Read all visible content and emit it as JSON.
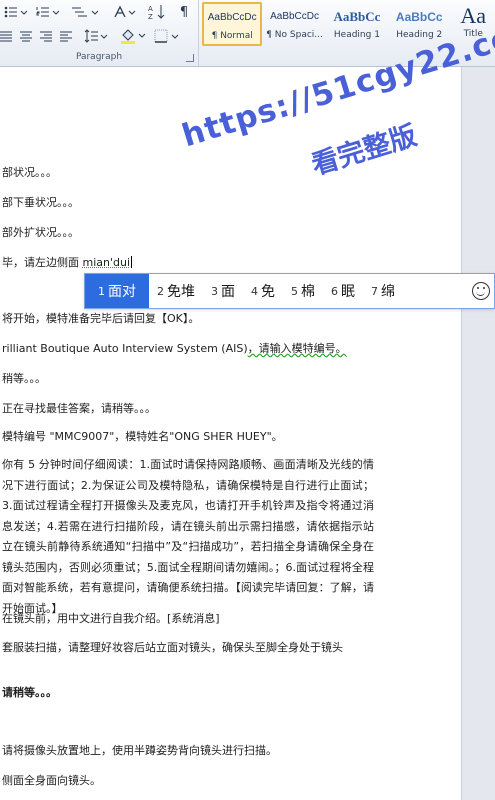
{
  "ribbon": {
    "paragraph_label": "Paragraph",
    "pilcrow": "¶",
    "sort_label": "A↓Z",
    "styles": [
      {
        "preview": "AaBbCcDc",
        "name": "¶ Normal",
        "active": true
      },
      {
        "preview": "AaBbCcDc",
        "name": "¶ No Spaci...",
        "active": false
      },
      {
        "preview": "AaBbCc",
        "name": "Heading 1",
        "active": false
      },
      {
        "preview": "AaBbCc",
        "name": "Heading 2",
        "active": false
      },
      {
        "preview": "Aa",
        "name": "Title",
        "active": false
      }
    ]
  },
  "watermark": {
    "line1": "https://51cgy22.com",
    "line2": "看完整版"
  },
  "document": {
    "lines": [
      "部状况。。。",
      "部下垂状况。。。",
      "部外扩状况。。。"
    ],
    "typing_line_prefix": "毕，请左边侧面 ",
    "typing_pinyin": "mian'dui",
    "line_after_ime": "将开始，模特准备完毕后请回复【OK】。",
    "system_line_prefix": "rilliant Boutique Auto Interview System (AIS)",
    "system_line_suffix": "，请输入模特编号。",
    "wait_line": "稍等。。。",
    "search_line": "正在寻找最佳答案，请稍等。。。",
    "model_line": "模特编号 \"MMC9007\"，模特姓名\"ONG SHER HUEY\"。",
    "notice_para": "你有 5 分钟时间仔细阅读：1.面试时请保持网路顺畅、画面清晰及光线的情况下进行面试；2.为保证公司及模特隐私，请确保模特是自行进行止面试；3.面试过程请全程打开摄像头及麦克风，也请打开手机铃声及指令将通过消息发送；4.若需在进行扫描阶段，请在镜头前出示需扫描感，请依据指示站立在镜头前静待系统通知“扫描中”及“扫描成功”，若扫描全身请确保全身在镜头范围内，否则必须重试；5.面试全程期间请勿嬉闹。；6.面试过程将全程面对智能系统，若有意提问，请确便系统扫描。【阅读完毕请回复：了解，请开始面试。】",
    "intro_line": "在镜头前，用中文进行自我介绍。[系统消息]",
    "scan_line": "套服装扫描，请整理好妆容后站立面对镜头，确保头至脚全身处于镜头",
    "bold_wait": "请稍等。。。",
    "camera_line": "请将摄像头放置地上，使用半蹲姿势背向镜头进行扫描。",
    "side_line": "侧面全身面向镜头。"
  },
  "ime": {
    "candidates": [
      {
        "num": "1",
        "text": "面对",
        "selected": true
      },
      {
        "num": "2",
        "text": "免堆",
        "selected": false
      },
      {
        "num": "3",
        "text": "面",
        "selected": false
      },
      {
        "num": "4",
        "text": "免",
        "selected": false
      },
      {
        "num": "5",
        "text": "棉",
        "selected": false
      },
      {
        "num": "6",
        "text": "眠",
        "selected": false
      },
      {
        "num": "7",
        "text": "绵",
        "selected": false
      }
    ]
  },
  "colors": {
    "accent": "#2d6cdf",
    "watermark": "#4a60d8",
    "active_style_border": "#e8b64a"
  }
}
